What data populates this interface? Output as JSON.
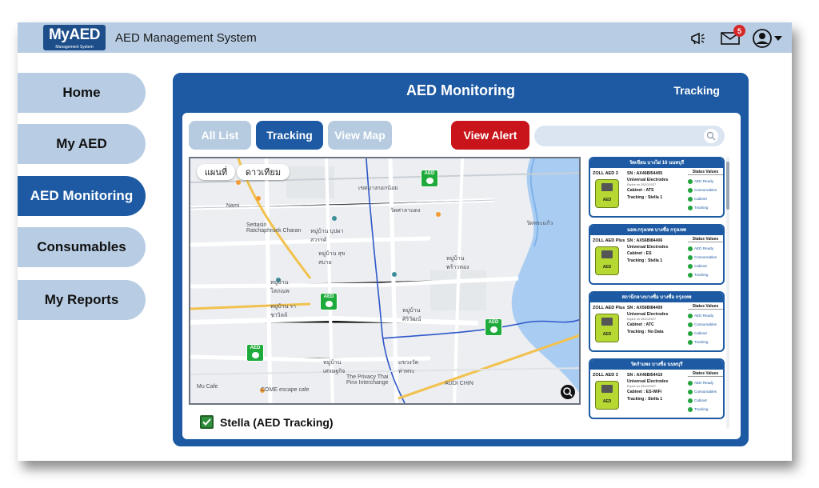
{
  "app": {
    "logo": "MyAED",
    "logo_sub": "Management System",
    "title": "AED Management System",
    "notif_count": "5",
    "icons": [
      "megaphone-icon",
      "mail-icon",
      "user-avatar-icon"
    ]
  },
  "sidebar": {
    "items": [
      {
        "label": "Home"
      },
      {
        "label": "My AED"
      },
      {
        "label": "AED Monitoring"
      },
      {
        "label": "Consumables"
      },
      {
        "label": "My Reports"
      }
    ],
    "active": "AED Monitoring"
  },
  "panel": {
    "title": "AED Monitoring",
    "mode": "Tracking"
  },
  "tabs": {
    "all": "All List",
    "tracking": "Tracking",
    "map": "View Map",
    "alert": "View Alert"
  },
  "search": {
    "placeholder": ""
  },
  "map": {
    "tab_map": "แผนที่",
    "tab_satellite": "ดาวเทียม",
    "pin_label": "AED",
    "labels": [
      "เขตบางกอกน้อย",
      "Nami",
      "Settasiri Ratchaphruek Charan",
      "หมู่บ้าน บุปผาสวรรค์",
      "หมู่บ้าน สุขสบาย",
      "หมู่บ้าน ราชาวิลล์",
      "หมู่บ้าน โสภณพ",
      "หมู่บ้าน เศรษฐกิจ",
      "The Privacy Thai Pinx Interchange",
      "COME escape cafe",
      "Mu Cafe",
      "AUDI CHIN",
      "แขวงวัด ท่าพระ",
      "หมู่บ้าน ศิริวัฒน์",
      "หมู่บ้าน พร้าวทอง",
      "วัดศาลาแดง",
      "วัดพระแก้ว"
    ]
  },
  "legend": {
    "label": "Stella (AED Tracking)"
  },
  "cards": [
    {
      "location": "วัดเขียน บางไผ่ 16 นนทบุรี",
      "model": "ZOLL AED 3",
      "sn": "SN : AX46BI54405",
      "electrode": "Universal Electrodes",
      "expire": "Expire on 25/10/2027",
      "cabinet": "Cabinet : ATS",
      "tracking": "Tracking : Stella 1",
      "img_label": "AED",
      "status_title": "Status Values",
      "status": [
        "AED Ready",
        "Consumables",
        "Cabinet",
        "Tracking"
      ]
    },
    {
      "location": "มอพ.กรุงเทพ บางซื่อ กรุงเทพ",
      "model": "ZOLL AED Plus",
      "sn": "SN : AX56BI84406",
      "electrode": "Universal Electrodes",
      "expire": "",
      "cabinet": "Cabinet : ES",
      "tracking": "Tracking : Stella 1",
      "img_label": "AED",
      "status_title": "Status Values",
      "status": [
        "AED Ready",
        "Consumables",
        "Cabinet",
        "Tracking"
      ]
    },
    {
      "location": "สถานีกลางบางซื่อ บางซื่อ กรุงเทพ",
      "model": "ZOLL AED Plus",
      "sn": "SN : AX56BI84409",
      "electrode": "Universal Electrodes",
      "expire": "Expire on 28/10/2027",
      "cabinet": "Cabinet : ATC",
      "tracking": "Tracking : No Data",
      "img_label": "AED",
      "status_title": "Status Values",
      "status": [
        "AED Ready",
        "Consumables",
        "Cabinet",
        "Tracking"
      ]
    },
    {
      "location": "วัดกำแพง บางซื่อ นนทบุรี",
      "model": "ZOLL AED 3",
      "sn": "SN : AX46BI54410",
      "electrode": "Universal Electrodes",
      "expire": "Expire on 28/10/2027",
      "cabinet": "Cabinet : ES-WiFi",
      "tracking": "Tracking : Stella 1",
      "img_label": "AED",
      "status_title": "Status Values",
      "status": [
        "AED Ready",
        "Consumables",
        "Cabinet",
        "Tracking"
      ]
    }
  ]
}
